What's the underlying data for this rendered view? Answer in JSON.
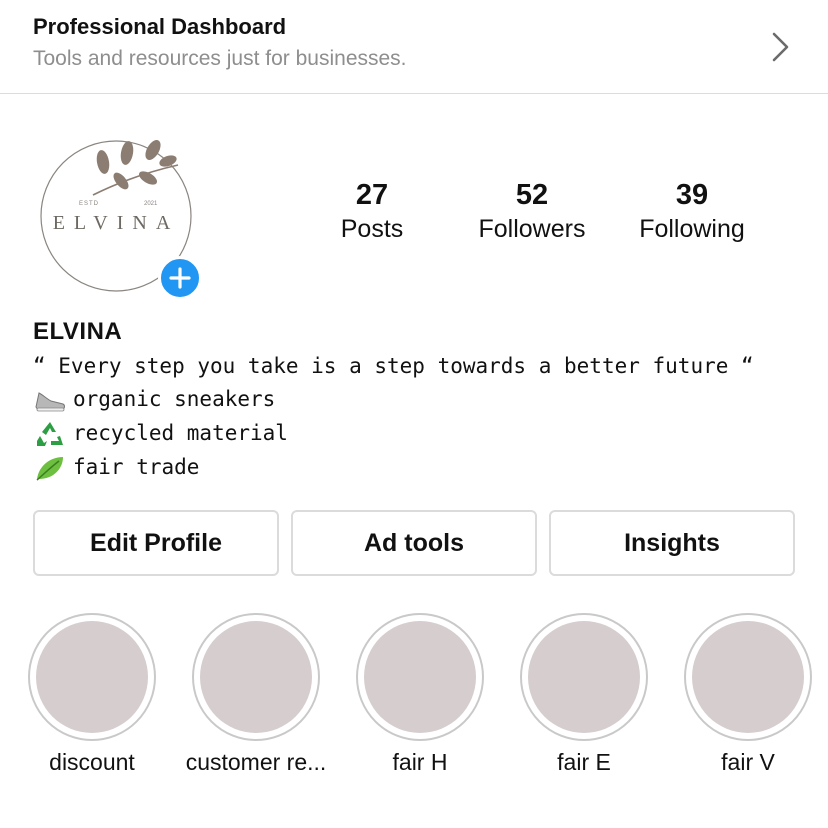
{
  "dashboard": {
    "title": "Professional Dashboard",
    "subtitle": "Tools and resources just for businesses.",
    "chevron_icon": "chevron-right-icon"
  },
  "profile": {
    "logo_text": "ELVINA",
    "logo_estd": "ESTD",
    "logo_year": "2021",
    "add_icon": "plus-icon",
    "add_color": "#2196f3"
  },
  "stats": {
    "posts": {
      "value": "27",
      "label": "Posts"
    },
    "followers": {
      "value": "52",
      "label": "Followers"
    },
    "following": {
      "value": "39",
      "label": "Following"
    }
  },
  "bio": {
    "name": "ELVINA",
    "quote": "“ Every step you take is a step towards a better future “",
    "lines": [
      {
        "icon": "sneaker-icon",
        "text": "organic sneakers"
      },
      {
        "icon": "recycle-icon",
        "text": "recycled material"
      },
      {
        "icon": "leaf-icon",
        "text": "fair trade"
      }
    ]
  },
  "actions": {
    "edit_profile": "Edit Profile",
    "ad_tools": "Ad tools",
    "insights": "Insights"
  },
  "highlights": [
    {
      "label": "discount"
    },
    {
      "label": "customer re..."
    },
    {
      "label": "fair H"
    },
    {
      "label": "fair E"
    },
    {
      "label": "fair V"
    }
  ]
}
